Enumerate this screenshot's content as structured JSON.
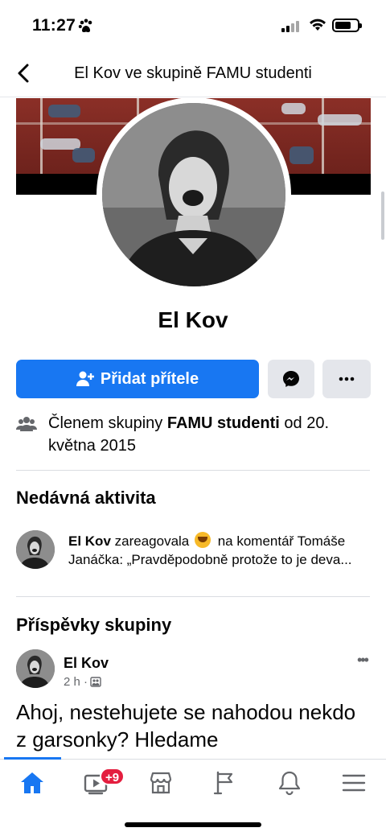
{
  "status_bar": {
    "time": "11:27"
  },
  "header": {
    "title": "El Kov ve skupině FAMU studenti"
  },
  "profile": {
    "name": "El Kov"
  },
  "actions": {
    "add_friend_label": "Přidat přítele"
  },
  "membership": {
    "prefix": "Členem skupiny ",
    "group": "FAMU studenti",
    "suffix": " od 20. května 2015"
  },
  "recent_activity": {
    "title": "Nedávná aktivita",
    "author": "El Kov",
    "verb": " zareagovala ",
    "rest_line1": " na komentář Tomáše",
    "line2": "Janáčka: „Pravděpodobně protože to je deva..."
  },
  "group_posts": {
    "title": "Příspěvky skupiny",
    "author": "El Kov",
    "time": "2 h ·",
    "body": "Ahoj, nestehujete se nahodou nekdo z garsonky? Hledame"
  },
  "tab_bar": {
    "video_badge": "+9",
    "tabs": [
      "home-icon",
      "video-icon",
      "marketplace-icon",
      "pages-flag-icon",
      "notifications-bell-icon",
      "menu-icon"
    ]
  },
  "colors": {
    "accent": "#1877f2",
    "badge": "#e41e3f",
    "button_gray": "#e4e6eb"
  }
}
